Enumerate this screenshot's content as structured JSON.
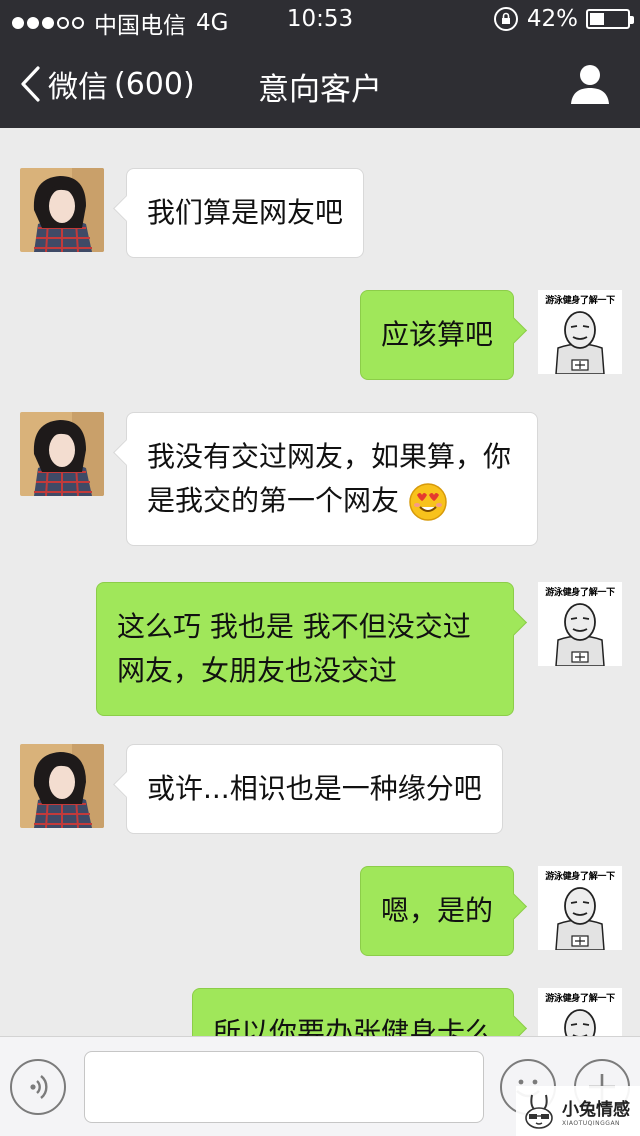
{
  "status_bar": {
    "carrier": "中国电信",
    "network": "4G",
    "time": "10:53",
    "battery": "42%",
    "battery_level": 0.42,
    "signal_dots_filled": 3,
    "signal_dots_total": 5
  },
  "nav": {
    "back_label": "微信",
    "unread_count": "(600)",
    "title": "意向客户",
    "profile_icon": "person-icon"
  },
  "messages": [
    {
      "side": "in",
      "lines": [
        "我们算是网友吧"
      ]
    },
    {
      "side": "out",
      "lines": [
        "应该算吧"
      ]
    },
    {
      "side": "in",
      "lines": [
        "我没有交过网友，如果算，你",
        "是我交的第一个网友"
      ],
      "trailing_emoji": "heart-eyes-emoji"
    },
    {
      "side": "out",
      "lines": [
        "这么巧 我也是 我不但没交过",
        "网友，女朋友也没交过"
      ]
    },
    {
      "side": "in",
      "lines": [
        "或许...相识也是一种缘分吧"
      ]
    },
    {
      "side": "out",
      "lines": [
        "嗯，是的"
      ]
    },
    {
      "side": "out",
      "lines": [
        "所以你要办张健身卡么"
      ]
    }
  ],
  "meme_avatar_caption": "游泳健身了解一下",
  "input_bar": {
    "voice_icon": "voice-icon",
    "emoji_icon": "smiley-icon",
    "plus_icon": "plus-icon"
  },
  "watermark": {
    "name": "小兔情感",
    "sub": "XIAOTUQINGGAN"
  },
  "colors": {
    "nav_bg": "#2e2e33",
    "chat_bg": "#ebebeb",
    "outgoing_bubble": "#a0e75a",
    "incoming_bubble": "#ffffff"
  }
}
